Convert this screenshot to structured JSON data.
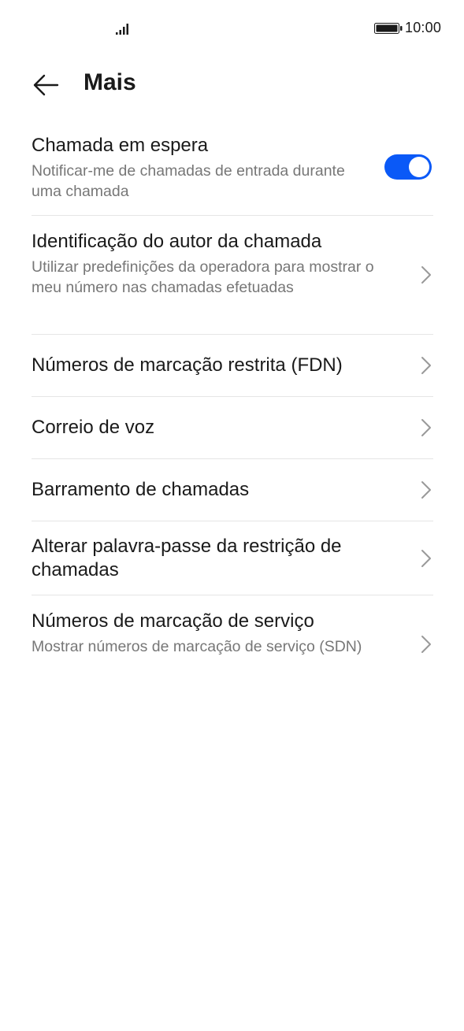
{
  "status_bar": {
    "time": "10:00",
    "signal_icon": "signal-bars-icon",
    "battery_icon": "battery-icon"
  },
  "header": {
    "title": "Mais",
    "back_icon": "arrow-left-icon"
  },
  "colors": {
    "accent": "#0a59f7",
    "divider": "#e5e5e5",
    "subtitle": "#777777"
  },
  "settings": {
    "call_waiting": {
      "title": "Chamada em espera",
      "subtitle": "Notificar-me de chamadas de entrada durante uma chamada",
      "toggle_on": true
    },
    "caller_id": {
      "title": "Identificação do autor da chamada",
      "subtitle": "Utilizar predefinições da operadora para mostrar o meu número nas chamadas efetuadas"
    },
    "fdn": {
      "title": "Números de marcação restrita (FDN)"
    },
    "voicemail": {
      "title": "Correio de voz"
    },
    "call_barring": {
      "title": "Barramento de chamadas"
    },
    "change_barring_password": {
      "title": "Alterar palavra-passe da restrição de chamadas"
    },
    "sdn": {
      "title": "Números de marcação de serviço",
      "subtitle": "Mostrar números de marcação de serviço (SDN)"
    }
  }
}
